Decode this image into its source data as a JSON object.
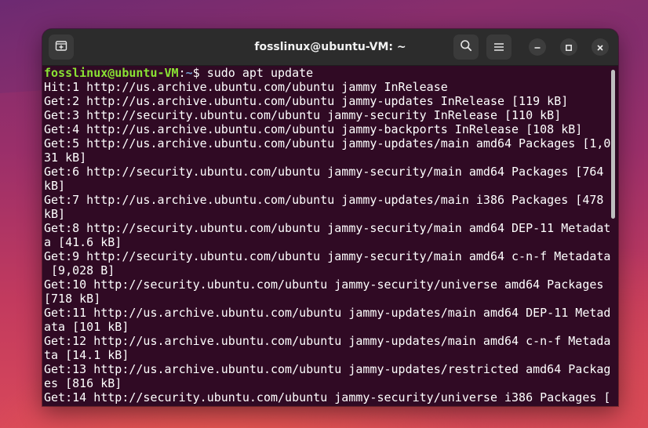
{
  "window": {
    "title": "fosslinux@ubuntu-VM: ~"
  },
  "colors": {
    "terminal_bg": "#300a24",
    "prompt_user": "#8ae234",
    "prompt_path": "#729fcf",
    "text": "#ffffff"
  },
  "icons": {
    "new_tab": "new-tab-icon",
    "search": "search-icon",
    "menu": "hamburger-menu-icon",
    "minimize": "minimize-icon",
    "maximize": "maximize-icon",
    "close": "close-icon"
  },
  "terminal": {
    "prompt": {
      "user_host": "fosslinux@ubuntu-VM",
      "separator": ":",
      "path": "~",
      "symbol": "$ ",
      "command": "sudo apt update"
    },
    "lines": [
      "Hit:1 http://us.archive.ubuntu.com/ubuntu jammy InRelease",
      "Get:2 http://us.archive.ubuntu.com/ubuntu jammy-updates InRelease [119 kB]",
      "Get:3 http://security.ubuntu.com/ubuntu jammy-security InRelease [110 kB]",
      "Get:4 http://us.archive.ubuntu.com/ubuntu jammy-backports InRelease [108 kB]",
      "Get:5 http://us.archive.ubuntu.com/ubuntu jammy-updates/main amd64 Packages [1,0",
      "31 kB]",
      "Get:6 http://security.ubuntu.com/ubuntu jammy-security/main amd64 Packages [764",
      "kB]",
      "Get:7 http://us.archive.ubuntu.com/ubuntu jammy-updates/main i386 Packages [478",
      "kB]",
      "Get:8 http://security.ubuntu.com/ubuntu jammy-security/main amd64 DEP-11 Metadat",
      "a [41.6 kB]",
      "Get:9 http://security.ubuntu.com/ubuntu jammy-security/main amd64 c-n-f Metadata",
      " [9,028 B]",
      "Get:10 http://security.ubuntu.com/ubuntu jammy-security/universe amd64 Packages",
      "[718 kB]",
      "Get:11 http://us.archive.ubuntu.com/ubuntu jammy-updates/main amd64 DEP-11 Metad",
      "ata [101 kB]",
      "Get:12 http://us.archive.ubuntu.com/ubuntu jammy-updates/main amd64 c-n-f Metada",
      "ta [14.1 kB]",
      "Get:13 http://us.archive.ubuntu.com/ubuntu jammy-updates/restricted amd64 Packag",
      "es [816 kB]",
      "Get:14 http://security.ubuntu.com/ubuntu jammy-security/universe i386 Packages ["
    ]
  }
}
